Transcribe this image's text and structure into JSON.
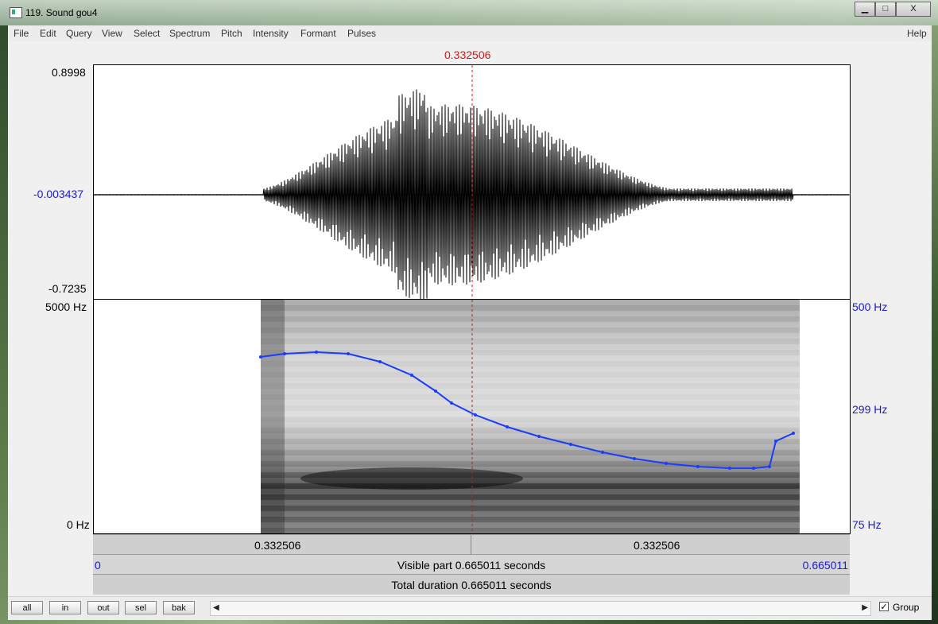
{
  "window": {
    "title": "119. Sound gou4",
    "controls": {
      "minimize": "▁",
      "maximize": "□",
      "close": "X"
    }
  },
  "menu": {
    "items": [
      "File",
      "Edit",
      "Query",
      "View",
      "Select",
      "Spectrum",
      "Pitch",
      "Intensity",
      "Formant",
      "Pulses"
    ],
    "help": "Help"
  },
  "waveform": {
    "cursor_time": "0.332506",
    "y_max": "0.8998",
    "y_mid": "-0.003437",
    "y_min": "-0.7235"
  },
  "spectrogram": {
    "freq_top": "5000 Hz",
    "freq_bottom": "0 Hz",
    "pitch_top": "500 Hz",
    "pitch_mid": "299 Hz",
    "pitch_bottom": "75 Hz",
    "pitch_color": "#1a3cff"
  },
  "time_bar": {
    "left": "0.332506",
    "right": "0.332506"
  },
  "visible_bar": {
    "start": "0",
    "text": "Visible part 0.665011 seconds",
    "end": "0.665011"
  },
  "total_bar": {
    "text": "Total duration 0.665011 seconds"
  },
  "buttons": {
    "all": "all",
    "in": "in",
    "out": "out",
    "sel": "sel",
    "bak": "bak"
  },
  "group": {
    "label": "Group",
    "checked": true
  }
}
